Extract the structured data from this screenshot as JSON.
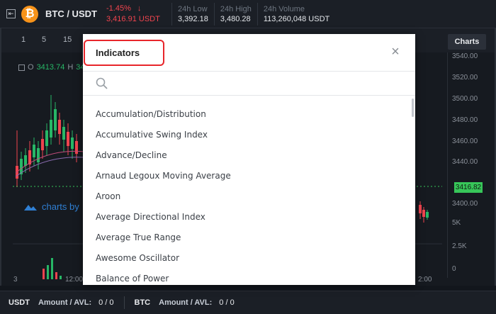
{
  "header": {
    "pair": "BTC / USDT",
    "change": "-1.45%",
    "change_arrow": "↓",
    "price": "3,416.91 USDT",
    "stats": [
      {
        "label": "24h Low",
        "value": "3,392.18"
      },
      {
        "label": "24h High",
        "value": "3,480.28"
      },
      {
        "label": "24h Volume",
        "value": "113,260,048 USDT"
      }
    ]
  },
  "chart": {
    "timeframes": [
      "1",
      "5",
      "15"
    ],
    "charts_tab": "Charts",
    "legend_o": "O",
    "legend_o_value": "3413.74",
    "legend_h": "H",
    "legend_h_value": "34",
    "price_ticks": [
      "3540.00",
      "3520.00",
      "3500.00",
      "3480.00",
      "3460.00",
      "3440.00",
      "3400.00"
    ],
    "volume_ticks": [
      "5K",
      "2.5K",
      "0"
    ],
    "current_price_tag": "3416.82",
    "watermark": "charts by",
    "x_labels": [
      "3",
      "12:00",
      "2:00"
    ]
  },
  "bottom": {
    "items": [
      {
        "currency": "USDT",
        "label": "Amount / AVL:",
        "value": "0 / 0"
      },
      {
        "currency": "BTC",
        "label": "Amount / AVL:",
        "value": "0 / 0"
      }
    ]
  },
  "modal": {
    "title": "Indicators",
    "close": "×",
    "search_placeholder": "",
    "indicators": [
      "Accumulation/Distribution",
      "Accumulative Swing Index",
      "Advance/Decline",
      "Arnaud Legoux Moving Average",
      "Aroon",
      "Average Directional Index",
      "Average True Range",
      "Awesome Oscillator",
      "Balance of Power"
    ]
  },
  "colors": {
    "down": "#f0444e",
    "up": "#27b766",
    "highlight": "#e8262b",
    "price_tag": "#37c659"
  }
}
